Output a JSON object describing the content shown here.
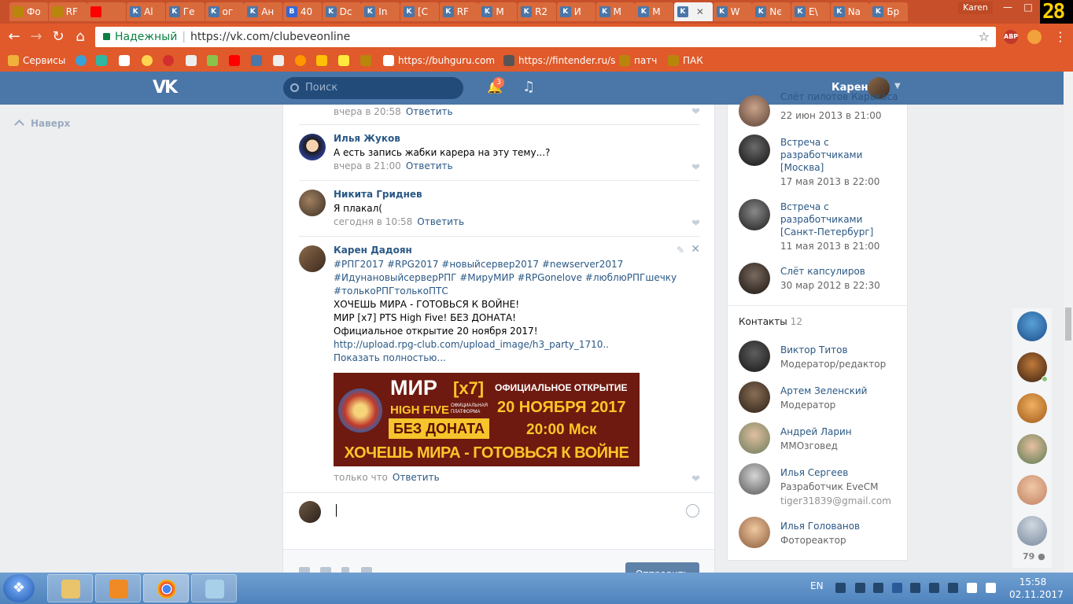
{
  "browser": {
    "tabs": [
      "Фо",
      "RF",
      "",
      "Al",
      "Ге",
      "ог",
      "Ан",
      "40",
      "Dc",
      "In",
      "[C",
      "RF",
      "M",
      "R2",
      "И",
      "M",
      "M",
      "",
      "W",
      "Nє",
      "E\\",
      "Na",
      "Бр"
    ],
    "profile": "Karen",
    "clock_overlay": "28",
    "address": {
      "secure_label": "Надежный",
      "url": "https://vk.com/clubeveonline"
    },
    "bookmarks": [
      "Сервисы",
      "https://buhguru.com",
      "https://fintender.ru/s",
      "патч",
      "ПАК"
    ]
  },
  "vk_header": {
    "logo": "VK",
    "search_placeholder": "Поиск",
    "notifications": "3",
    "user_name": "Карен"
  },
  "left": {
    "back_to_top": "Наверх"
  },
  "comments": [
    {
      "author": "",
      "text": "",
      "time": "вчера в 20:58",
      "reply": "Ответить"
    },
    {
      "author": "Илья Жуков",
      "text": "А есть запись жабки карера на эту тему...?",
      "time": "вчера в 21:00",
      "reply": "Ответить"
    },
    {
      "author": "Никита Гриднев",
      "text": "Я плакал(",
      "time": "сегодня в 10:58",
      "reply": "Ответить"
    },
    {
      "author": "Карен Дадоян",
      "lines": [
        "#РПГ2017 #RPG2017 #новыйсервер2017 #newserver2017",
        "#ИдунановыйсерверРПГ #МируМИР #RPGonelove #люблюРПГшечку",
        "#толькоРПГтолькоПТС",
        "ХОЧЕШЬ МИРА - ГОТОВЬСЯ К ВОЙНЕ!",
        "МИР [x7] PTS High Five! БЕЗ ДОНАТА!",
        "Официальное открытие 20 ноября 2017!",
        "http://upload.rpg-club.com/upload_image/h3_party_1710..",
        "Показать полностью..."
      ],
      "time": "только что",
      "reply": "Ответить"
    }
  ],
  "banner": {
    "mir": "МИР",
    "x7": "[x7]",
    "high_five": "HIGH FIVE",
    "official": "ОФИЦИАЛЬНАЯ ПЛАТФОРМА",
    "no_donate": "БЕЗ ДОНАТА",
    "opening": "ОФИЦИАЛЬНОЕ ОТКРЫТИЕ",
    "date": "20 НОЯБРЯ 2017",
    "time": "20:00 Мск",
    "slogan": "ХОЧЕШЬ МИРА - ГОТОВЬСЯ К ВОЙНЕ"
  },
  "composer": {
    "send_label": "Отправить"
  },
  "events": [
    {
      "title": "Слёт пилотов Каракаса",
      "date": "22 июн 2013 в 21:00"
    },
    {
      "title": "Встреча с разработчиками [Москва]",
      "date": "17 мая 2013 в 22:00"
    },
    {
      "title": "Встреча с разработчиками [Санкт-Петербург]",
      "date": "11 мая 2013 в 21:00"
    },
    {
      "title": "Слёт капсулиров",
      "date": "30 мар 2012 в 22:30"
    }
  ],
  "contacts": {
    "heading": "Контакты",
    "count": "12",
    "items": [
      {
        "name": "Виктор Титов",
        "role": "Модератор/редактор"
      },
      {
        "name": "Артем Зеленский",
        "role": "Модератор"
      },
      {
        "name": "Андрей Ларин",
        "role": "MMOзговед"
      },
      {
        "name": "Илья Сергеев",
        "role": "Разработчик EveCM",
        "email": "tiger31839@gmail.com"
      },
      {
        "name": "Илья Голованов",
        "role": "Фотореактор"
      }
    ]
  },
  "online": {
    "count": "79"
  },
  "taskbar": {
    "lang": "EN",
    "time": "15:58",
    "date": "02.11.2017"
  },
  "colors": {
    "vk_blue": "#4a76a8",
    "link": "#2a5885",
    "chrome_orange": "#e05a2b"
  }
}
